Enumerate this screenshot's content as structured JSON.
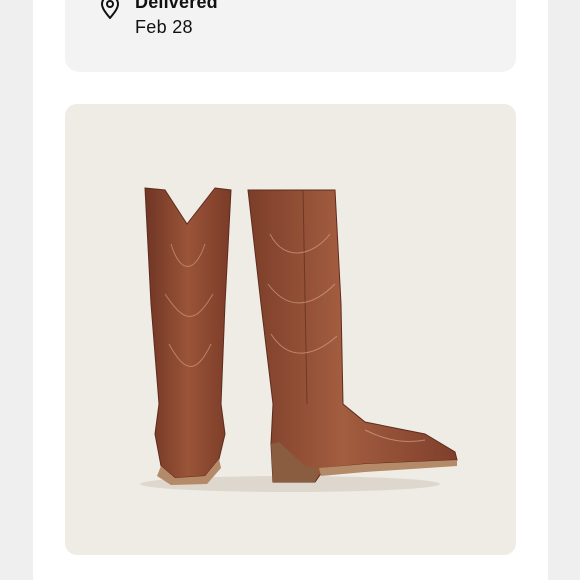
{
  "delivery": {
    "icon": "location-pin-icon",
    "status": "Delivered",
    "date": "Feb 28"
  },
  "product": {
    "image_icon": "cowboy-boots-image",
    "colors": {
      "card_bg": "#efebe5",
      "leather": "#8c4a33",
      "leather_dark": "#6e3624",
      "sole": "#9a6a4a"
    }
  }
}
